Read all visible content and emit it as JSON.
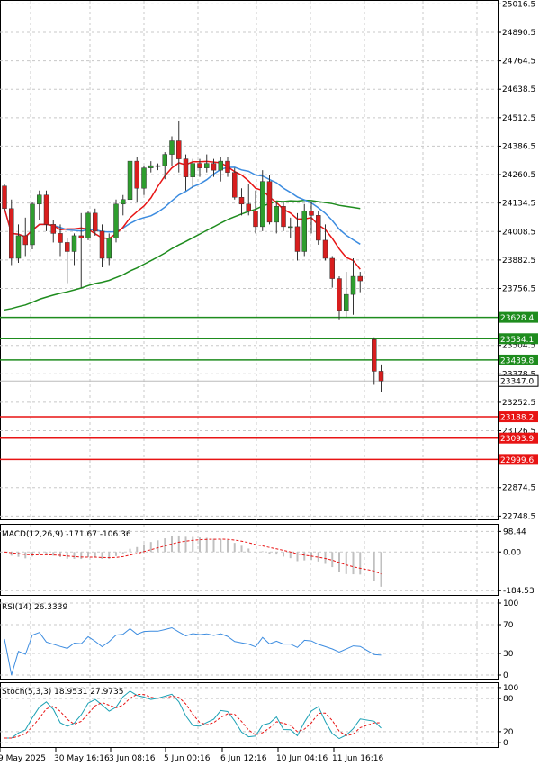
{
  "colors": {
    "bull": "#2e9e2e",
    "bear": "#d81e1e",
    "ma_fast": "#e81414",
    "ma_mid": "#3c8ce0",
    "ma_slow": "#1e8c1e",
    "support": "#1e8c1e",
    "resistance": "#e81414",
    "price_box": "#ffffff"
  },
  "chart_data": [
    {
      "type": "candlestick",
      "title": "",
      "y_ticks": [
        "25016.5",
        "24890.5",
        "24764.5",
        "24638.5",
        "24512.5",
        "24386.5",
        "24260.5",
        "24134.5",
        "24008.5",
        "23882.5",
        "23756.5",
        "23504.5",
        "23378.5",
        "23252.5",
        "23126.5",
        "22874.5",
        "22748.5"
      ],
      "ylim": [
        22730,
        25030
      ],
      "x_labels": [
        "9 May 2025",
        "30 May 16:16",
        "3 Jun 08:16",
        "5 Jun 00:16",
        "6 Jun 12:16",
        "10 Jun 04:16",
        "11 Jun 16:16"
      ],
      "current_price": "23347.0",
      "levels": [
        {
          "label": "23628.4",
          "value": 23628.4,
          "kind": "support"
        },
        {
          "label": "23534.1",
          "value": 23534.1,
          "kind": "support"
        },
        {
          "label": "23439.8",
          "value": 23439.8,
          "kind": "support"
        },
        {
          "label": "23188.2",
          "value": 23188.2,
          "kind": "resistance"
        },
        {
          "label": "23093.9",
          "value": 23093.9,
          "kind": "resistance"
        },
        {
          "label": "22999.6",
          "value": 22999.6,
          "kind": "resistance"
        }
      ],
      "candles": [
        [
          24210,
          24220,
          24100,
          24110
        ],
        [
          24110,
          24150,
          23860,
          23890
        ],
        [
          23890,
          24040,
          23870,
          23990
        ],
        [
          23990,
          24070,
          23900,
          23950
        ],
        [
          23950,
          24140,
          23930,
          24130
        ],
        [
          24130,
          24190,
          24060,
          24170
        ],
        [
          24170,
          24190,
          24010,
          24040
        ],
        [
          24040,
          24060,
          23960,
          24000
        ],
        [
          24000,
          24040,
          23900,
          23960
        ],
        [
          23960,
          23980,
          23780,
          23920
        ],
        [
          23920,
          24000,
          23860,
          23990
        ],
        [
          23990,
          24090,
          23760,
          23980
        ],
        [
          23980,
          24100,
          23970,
          24090
        ],
        [
          24090,
          24110,
          23990,
          24010
        ],
        [
          24010,
          24040,
          23850,
          23890
        ],
        [
          23890,
          24000,
          23860,
          23980
        ],
        [
          23980,
          24150,
          23960,
          24130
        ],
        [
          24130,
          24170,
          24080,
          24150
        ],
        [
          24150,
          24350,
          24140,
          24320
        ],
        [
          24320,
          24340,
          24140,
          24200
        ],
        [
          24200,
          24300,
          24170,
          24290
        ],
        [
          24290,
          24320,
          24270,
          24300
        ],
        [
          24300,
          24310,
          24280,
          24300
        ],
        [
          24300,
          24360,
          24240,
          24350
        ],
        [
          24350,
          24430,
          24300,
          24410
        ],
        [
          24410,
          24500,
          24270,
          24330
        ],
        [
          24330,
          24350,
          24190,
          24250
        ],
        [
          24250,
          24330,
          24200,
          24310
        ],
        [
          24310,
          24330,
          24250,
          24290
        ],
        [
          24290,
          24350,
          24270,
          24310
        ],
        [
          24310,
          24330,
          24250,
          24280
        ],
        [
          24280,
          24340,
          24230,
          24320
        ],
        [
          24320,
          24340,
          24250,
          24270
        ],
        [
          24270,
          24290,
          24150,
          24160
        ],
        [
          24160,
          24200,
          24080,
          24130
        ],
        [
          24130,
          24220,
          24080,
          24100
        ],
        [
          24100,
          24190,
          24000,
          24030
        ],
        [
          24030,
          24280,
          24010,
          24230
        ],
        [
          24230,
          24260,
          24040,
          24050
        ],
        [
          24050,
          24140,
          24000,
          24120
        ],
        [
          24120,
          24140,
          24010,
          24030
        ],
        [
          24030,
          24070,
          23980,
          24030
        ],
        [
          24030,
          24090,
          23880,
          23920
        ],
        [
          23920,
          24130,
          23900,
          24100
        ],
        [
          24100,
          24140,
          24000,
          24080
        ],
        [
          24080,
          24100,
          23950,
          23970
        ],
        [
          23970,
          24040,
          23880,
          23890
        ],
        [
          23890,
          23900,
          23760,
          23800
        ],
        [
          23800,
          23810,
          23620,
          23660
        ],
        [
          23660,
          23830,
          23630,
          23730
        ],
        [
          23730,
          23890,
          23640,
          23810
        ],
        [
          23810,
          23830,
          23740,
          23790
        ],
        [
          23530,
          23540,
          23330,
          23390
        ],
        [
          23390,
          23420,
          23300,
          23347
        ]
      ]
    },
    {
      "type": "bar",
      "title": "MACD(12,26,9) -171.67 -106.36",
      "y_ticks": [
        "98.44",
        "0.00",
        "-184.53"
      ],
      "ylim": [
        -205,
        130
      ]
    },
    {
      "type": "line",
      "title": "RSI(14) 26.3339",
      "y_ticks": [
        "100",
        "70",
        "30",
        "0"
      ],
      "ylim": [
        -5,
        105
      ]
    },
    {
      "type": "line",
      "title": "Stoch(5,3,3) 18.9531 27.9735",
      "y_ticks": [
        "100",
        "80",
        "20",
        "0"
      ],
      "ylim": [
        -8,
        108
      ]
    }
  ]
}
